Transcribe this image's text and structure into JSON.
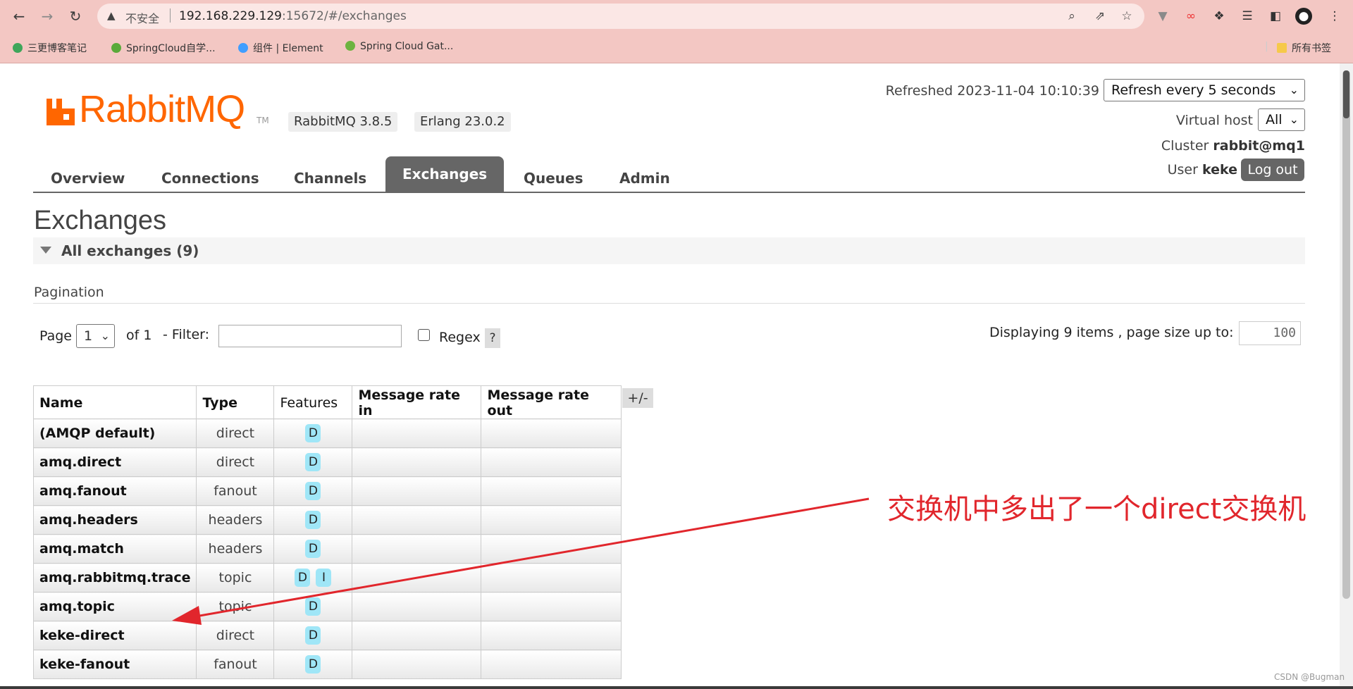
{
  "browser": {
    "security_label": "不安全",
    "url_host": "192.168.229.129",
    "url_path": ":15672/#/exchanges",
    "bookmarks": [
      {
        "label": "三更博客笔记",
        "color": "#3ea65a"
      },
      {
        "label": "SpringCloud自学...",
        "color": "#5aaa3a"
      },
      {
        "label": "组件 | Element",
        "color": "#409eff"
      },
      {
        "label": "Spring Cloud Gat...",
        "color": "#6db33f"
      }
    ],
    "all_bookmarks_label": "所有书签"
  },
  "header": {
    "logo_text": "RabbitMQ",
    "logo_tm": "TM",
    "brand_color": "#ff6600",
    "version": "RabbitMQ 3.8.5",
    "erlang": "Erlang 23.0.2",
    "refreshed_label": "Refreshed 2023-11-04 10:10:39",
    "refresh_option": "Refresh every 5 seconds",
    "vhost_label": "Virtual host",
    "vhost_value": "All",
    "cluster_label": "Cluster",
    "cluster_value": "rabbit@mq1",
    "user_label": "User",
    "user_value": "keke",
    "logout_label": "Log out"
  },
  "tabs": [
    {
      "label": "Overview",
      "active": false
    },
    {
      "label": "Connections",
      "active": false
    },
    {
      "label": "Channels",
      "active": false
    },
    {
      "label": "Exchanges",
      "active": true
    },
    {
      "label": "Queues",
      "active": false
    },
    {
      "label": "Admin",
      "active": false
    }
  ],
  "page": {
    "title": "Exchanges",
    "section_label": "All exchanges (9)",
    "pagination_label": "Pagination",
    "page_label": "Page",
    "page_value": "1",
    "of_label": "of 1",
    "filter_label": "- Filter:",
    "filter_value": "",
    "regex_label": "Regex",
    "regex_checked": false,
    "help_label": "?",
    "displaying_label": "Displaying 9 items , page size up to:",
    "page_size": "100"
  },
  "table": {
    "columns": [
      "Name",
      "Type",
      "Features",
      "Message rate in",
      "Message rate out"
    ],
    "plusminus_label": "+/-",
    "rows": [
      {
        "name": "(AMQP default)",
        "type": "direct",
        "features": [
          "D"
        ]
      },
      {
        "name": "amq.direct",
        "type": "direct",
        "features": [
          "D"
        ]
      },
      {
        "name": "amq.fanout",
        "type": "fanout",
        "features": [
          "D"
        ]
      },
      {
        "name": "amq.headers",
        "type": "headers",
        "features": [
          "D"
        ]
      },
      {
        "name": "amq.match",
        "type": "headers",
        "features": [
          "D"
        ]
      },
      {
        "name": "amq.rabbitmq.trace",
        "type": "topic",
        "features": [
          "D",
          "I"
        ]
      },
      {
        "name": "amq.topic",
        "type": "topic",
        "features": [
          "D"
        ]
      },
      {
        "name": "keke-direct",
        "type": "direct",
        "features": [
          "D"
        ]
      },
      {
        "name": "keke-fanout",
        "type": "fanout",
        "features": [
          "D"
        ]
      }
    ]
  },
  "annotation": {
    "text": "交换机中多出了一个direct交换机",
    "color": "#e1262c"
  },
  "watermark": "CSDN @Bugman"
}
